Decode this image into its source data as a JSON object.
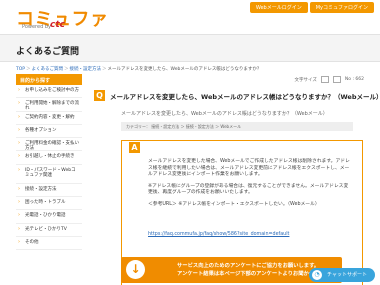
{
  "header": {
    "logo": "コミュファ",
    "logo_sub": "Powered by",
    "logo_brand": "ctc",
    "links": [
      "Webメールログイン",
      "Myコミュファログイン"
    ]
  },
  "page_title": "よくあるご質問",
  "breadcrumb": [
    "TOP",
    "よくあるご質問",
    "接続・設定方法",
    "メールアドレスを変更したら、Webメールのアドレス帳はどうなりますか？"
  ],
  "meta": {
    "label": "文字サイズ",
    "id": "No : 662"
  },
  "sidebar": {
    "heading": "目的から探す",
    "items": [
      "お申し込みをご検討中の方",
      "ご利用開始・解除までの流れ",
      "ご契約内容・変更・解約",
      "各種オプション",
      "ご利用料金の確認・支払い方法",
      "お引越し・休止の手続き",
      "ID・パスワード・Webコミュファ関連",
      "接続・設定方法",
      "困った時・トラブル",
      "光電話・ひかり電話",
      "光テレビ・ひかりTV",
      "その他"
    ]
  },
  "question": {
    "badge": "Q",
    "title": "メールアドレスを変更したら、Webメールのアドレス帳はどうなりますか？（Webメール）",
    "subtitle": "メールアドレスを変更したら、Webメールのアドレス帳はどうなりますか？（Webメール）",
    "category": "カテゴリー： 接続・設定方法 ＞ 接続・設定方法 ＞ Webメール"
  },
  "answer": {
    "badge": "A",
    "paragraphs": [
      "メールアドレスを変更した場合、Webメールでご作成したアドレス帳は削除されます。アドレス帳を継続で利用したい場合は、メールアドレス変更前にアドレス帳をエクスポートし、メールアドレス変更後にインポート作業をお願いします。",
      "※アドレス帳にグループの登録がある場合は、復元することができません。メールアドレス変更後、再度グループの作成をお願いいたします。",
      "＜参考URL＞ ※アドレス帳をインポート・エクスポートしたい。（Webメール）"
    ],
    "link": "https://faq.commufa.jp/faq/show/586?site_domain=default"
  },
  "banner": {
    "line1": "サービス向上のためのアンケートにご協力をお願いします。",
    "line2": "アンケート結果は本ページ下部のアンケートよりお聞かせください。"
  },
  "chat": {
    "label": "チャットサポート"
  }
}
